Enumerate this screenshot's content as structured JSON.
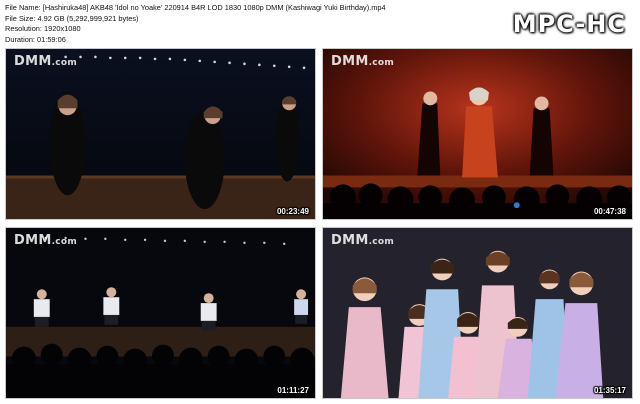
{
  "file_info": {
    "file_name": "File Name: [Hashiruka48] AKB48 'Idol no Yoake' 220914 B4R LOD 1830 1080p DMM (Kashiwagi Yuki Birthday).mp4",
    "file_size": "File Size: 4.92 GB (5,292,999,921 bytes)",
    "resolution": "Resolution: 1920x1080",
    "duration": "Duration: 01:59:06"
  },
  "brand": "MPC-HC",
  "thumbnails": [
    {
      "watermark": "DMM",
      "watermark_suffix": ".com",
      "timestamp": "00:23:49"
    },
    {
      "watermark": "DMM",
      "watermark_suffix": ".com",
      "timestamp": "00:47:38"
    },
    {
      "watermark": "DMM",
      "watermark_suffix": ".com",
      "timestamp": "01:11:27"
    },
    {
      "watermark": "DMM",
      "watermark_suffix": ".com",
      "timestamp": "01:35:17"
    }
  ]
}
